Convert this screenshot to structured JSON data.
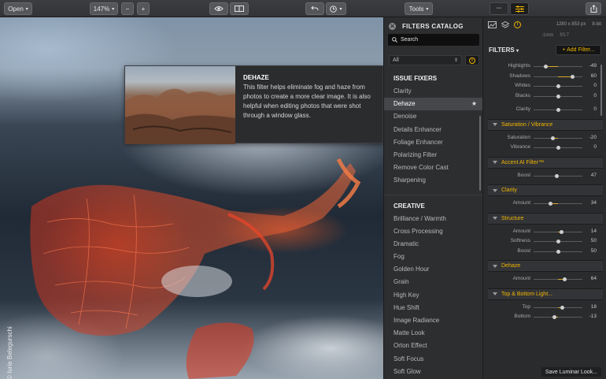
{
  "toolbar": {
    "open_label": "Open",
    "zoom_value": "147%",
    "zoom_minus": "−",
    "zoom_plus": "+",
    "tools_label": "Tools",
    "view_toggle_label": "◦◦◦"
  },
  "canvas": {
    "photo_credit": "© Iurie Belegurschi"
  },
  "tooltip": {
    "title": "DEHAZE",
    "description": "This filter helps eliminate fog and haze from photos to create a more clear image. It is also helpful when editing photos that were shot through a window glass."
  },
  "catalog": {
    "title": "FILTERS CATALOG",
    "search_placeholder": "Search",
    "category_select": "All",
    "sections": [
      {
        "title": "ISSUE FIXERS",
        "items": [
          "Clarity",
          "Dehaze",
          "Denoise",
          "Details Enhancer",
          "Foliage Enhancer",
          "Polarizing Filter",
          "Remove Color Cast",
          "Sharpening"
        ]
      },
      {
        "title": "CREATIVE",
        "items": [
          "Brilliance / Warmth",
          "Cross Processing",
          "Dramatic",
          "Fog",
          "Golden Hour",
          "Grain",
          "High Key",
          "Hue Shift",
          "Image Radiance",
          "Matte Look",
          "Orton Effect",
          "Soft Focus",
          "Soft Glow"
        ]
      }
    ],
    "selected_item": "Dehaze"
  },
  "panel": {
    "dimensions": "1280 x 853 px",
    "bit_depth": "8-bit",
    "focal": "-1mm",
    "aperture": "f/0.7",
    "filters_header": "FILTERS",
    "add_filter_label": "+ Add Filter...",
    "top_sliders": [
      {
        "label": "Highlights",
        "value": "-49",
        "pos": 0.25
      },
      {
        "label": "Shadows",
        "value": "60",
        "pos": 0.8
      },
      {
        "label": "Whites",
        "value": "0",
        "pos": 0.5
      },
      {
        "label": "Blacks",
        "value": "0",
        "pos": 0.5
      }
    ],
    "clarity_slider": {
      "label": "Clarity",
      "value": "0",
      "pos": 0.5
    },
    "sections": [
      {
        "title": "Saturation / Vibrance",
        "sliders": [
          {
            "label": "Saturation",
            "value": "-20",
            "pos": 0.4
          },
          {
            "label": "Vibrance",
            "value": "0",
            "pos": 0.5
          }
        ]
      },
      {
        "title": "Accent AI Filter™",
        "sliders": [
          {
            "label": "Boost",
            "value": "47",
            "pos": 0.47
          }
        ]
      },
      {
        "title": "Clarity",
        "sliders": [
          {
            "label": "Amount",
            "value": "34",
            "pos": 0.34
          }
        ]
      },
      {
        "title": "Structure",
        "sliders": [
          {
            "label": "Amount",
            "value": "14",
            "pos": 0.57
          },
          {
            "label": "Softness",
            "value": "50",
            "pos": 0.5
          },
          {
            "label": "Boost",
            "value": "50",
            "pos": 0.5
          }
        ]
      },
      {
        "title": "Dehaze",
        "sliders": [
          {
            "label": "Amount",
            "value": "64",
            "pos": 0.64
          }
        ]
      },
      {
        "title": "Top & Bottom Light...",
        "sliders": [
          {
            "label": "Top",
            "value": "18",
            "pos": 0.59
          },
          {
            "label": "Bottom",
            "value": "-13",
            "pos": 0.43
          }
        ]
      }
    ],
    "save_label": "Save Luminar Look..."
  },
  "colors": {
    "accent": "#f2b600",
    "lava": "#e8452a",
    "panel_bg": "#2a2b2d"
  }
}
